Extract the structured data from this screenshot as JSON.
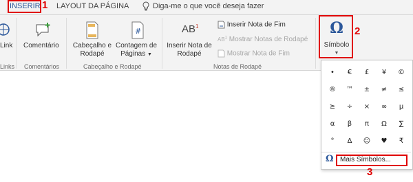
{
  "tabs": {
    "inserir": "INSERIR",
    "layout": "LAYOUT DA PÁGINA",
    "tell_me": "Diga-me o que você deseja fazer"
  },
  "annotations": [
    "1",
    "2",
    "3"
  ],
  "ribbon": {
    "link_label": "Link",
    "links_group": "Links",
    "comentario_label": "Comentário",
    "comentarios_group": "Comentários",
    "cabecalho_label_1": "Cabeçalho e",
    "cabecalho_label_2": "Rodapé",
    "contagem_label_1": "Contagem de",
    "contagem_label_2": "Páginas",
    "cabecalho_group": "Cabeçalho e Rodapé",
    "inserir_nota_rodape_1": "Inserir Nota de",
    "inserir_nota_rodape_2": "Rodapé",
    "inserir_nota_fim": "Inserir Nota de Fim",
    "proxima_nota": "Mostrar Notas de Rodapé",
    "mostrar_notas": "Mostrar Nota de Fim",
    "notas_group": "Notas de Rodapé",
    "simbolo_label": "Símbolo",
    "simbolo_glyph": "Ω",
    "ab_glyph": "AB",
    "ab_sup": "1"
  },
  "symbols": [
    "•",
    "€",
    "£",
    "¥",
    "©",
    "®",
    "™",
    "±",
    "≠",
    "≤",
    "≥",
    "÷",
    "×",
    "∞",
    "µ",
    "α",
    "β",
    "π",
    "Ω",
    "∑",
    "°",
    "Δ",
    "☺",
    "♥",
    "₹"
  ],
  "more_symbols": "Mais Símbolos...",
  "colors": {
    "accent": "#2b579a",
    "highlight": "#e00000"
  }
}
